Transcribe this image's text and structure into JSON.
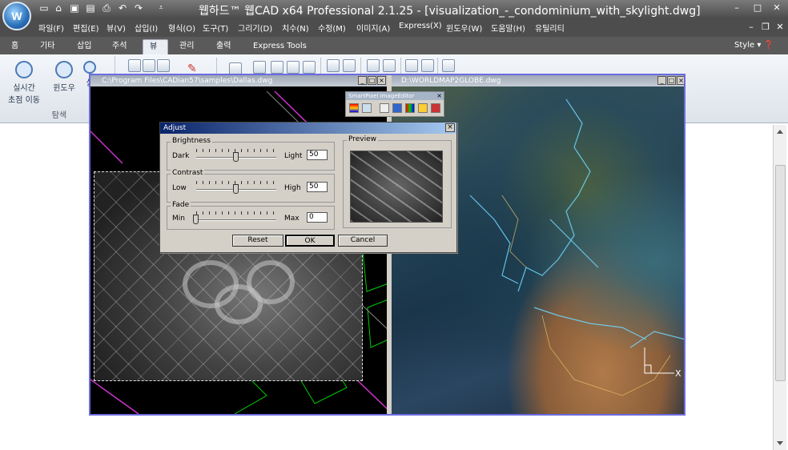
{
  "app": {
    "title": "웹하드™ 웹CAD x64 Professional 2.1.25 - [visualization_-_condominium_with_skylight.dwg]",
    "logo_letter": "W"
  },
  "menu": [
    "파일(F)",
    "편집(E)",
    "뷰(V)",
    "삽입(I)",
    "형식(O)",
    "도구(T)",
    "그리기(D)",
    "치수(N)",
    "수정(M)",
    "이미지(A)",
    "Express(X)",
    "윈도우(W)",
    "도움말(H)",
    "유틸리티"
  ],
  "tabs": [
    {
      "label": "홈"
    },
    {
      "label": "기타"
    },
    {
      "label": "삽입"
    },
    {
      "label": "주석"
    },
    {
      "label": "뷰"
    },
    {
      "label": "관리"
    },
    {
      "label": "출력"
    },
    {
      "label": "Express Tools"
    }
  ],
  "style_menu": "Style",
  "ribbon": {
    "realtime_zoom_line1": "실시간",
    "realtime_zoom_line2": "초점 이동",
    "window_label": "윈도우",
    "third_label": "실",
    "group_label": "탐색"
  },
  "doc_left": {
    "title": "C:\\Program Files\\CADian57\\samples\\Dallas.dwg"
  },
  "doc_right": {
    "title": "D:\\WORLDMAP2GLOBE.dwg"
  },
  "smartpixel": {
    "title": "SmartPixel ImageEditor"
  },
  "adjust": {
    "title": "Adjust",
    "brightness": {
      "label": "Brightness",
      "min_label": "Dark",
      "max_label": "Light",
      "value": "50"
    },
    "contrast": {
      "label": "Contrast",
      "min_label": "Low",
      "max_label": "High",
      "value": "50"
    },
    "fade": {
      "label": "Fade",
      "min_label": "Min",
      "max_label": "Max",
      "value": "0"
    },
    "preview_label": "Preview",
    "reset": "Reset",
    "ok": "OK",
    "cancel": "Cancel"
  },
  "colors": {
    "accent": "#6b6be0",
    "titlebar": "#5a5a5a",
    "dialog": "#d4d0c8"
  }
}
